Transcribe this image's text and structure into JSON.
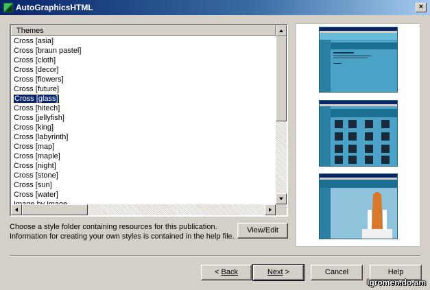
{
  "window": {
    "title": "AutoGraphicsHTML",
    "close_glyph": "×"
  },
  "themes": {
    "header": "Themes",
    "items": [
      "Cross [asia]",
      "Cross [braun pastel]",
      "Cross [cloth]",
      "Cross [decor]",
      "Cross [flowers]",
      "Cross [future]",
      "Cross [glass]",
      "Cross [hitech]",
      "Cross [jellyfish]",
      "Cross [king]",
      "Cross [labyrinth]",
      "Cross [map]",
      "Cross [maple]",
      "Cross [night]",
      "Cross [stone]",
      "Cross [sun]",
      "Cross [water]",
      "Image by image"
    ],
    "selected_index": 6
  },
  "description": {
    "line1": "Choose a style folder containing resources for this publication.",
    "line2": "Information for creating your own styles is contained in the help file."
  },
  "buttons": {
    "view_edit": "View/Edit",
    "back": "Back",
    "back_prefix": "< ",
    "next": "Next",
    "next_suffix": " >",
    "cancel": "Cancel",
    "help": "Help"
  },
  "watermark": "Igromen.do.am",
  "colors": {
    "titlebar": "#0a246a",
    "selection": "#0a246a",
    "theme_blue": "#4aa3c6"
  }
}
